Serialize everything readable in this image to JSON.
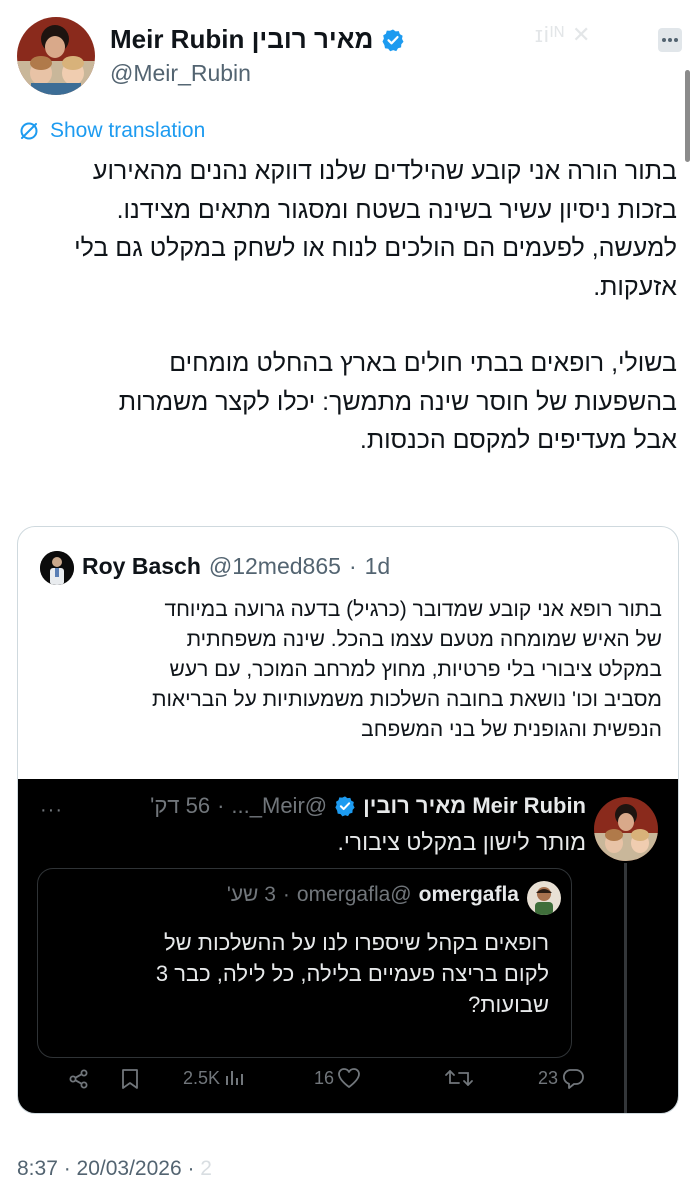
{
  "author": {
    "name": "Meir Rubin מאיר רובין",
    "handle": "@Meir_Rubin",
    "verified": true
  },
  "ghost_logo": "ɪiᴵᴺ ✕",
  "translate_label": "Show translation",
  "body": {
    "paragraph1": "בתור הורה אני קובע שהילדים שלנו דווקא נהנים מהאירוע\nבזכות ניסיון עשיר בשינה בשטח ומסגור מתאים מצידנו.\nלמעשה, לפעמים הם הולכים לנוח או לשחק במקלט גם בלי\nאזעקות.",
    "paragraph2": "בשולי, רופאים בבתי חולים בארץ בהחלט מומחים\nבהשפעות של חוסר שינה מתמשך: יכלו לקצר משמרות\nאבל מעדיפים למקסם הכנסות."
  },
  "quote": {
    "name": "Roy Basch",
    "handle": "@12med865",
    "time": "1d",
    "text": "בתור רופא אני קובע שמדובר (כרגיל) בדעה גרועה במיוחד\nשל האיש שמומחה מטעם עצמו בהכל. שינה משפחתית\nבמקלט ציבורי בלי פרטיות, מחוץ למרחב המוכר, עם רעש\nמסביב וכו' נושאת בחובה השלכות משמעותיות על הבריאות\nהנפשית והגופנית של בני המשפחב",
    "embedded": {
      "name": "Meir Rubin מאיר רובין",
      "handle": "@Meir_...",
      "time": "56 דק'",
      "text": "מותר לישון במקלט ציבורי.",
      "more": "···",
      "inner": {
        "name": "omergafla",
        "handle": "@omergafla",
        "time": "3 שע'",
        "text": "רופאים בקהל שיספרו לנו על ההשלכות של\nלקום בריצה פעמיים בלילה, כל לילה, כבר 3\nשבועות?"
      },
      "actions": {
        "views": "2.5K",
        "likes": "16",
        "replies": "23"
      }
    }
  },
  "timestamp": {
    "time": "8:37 · 20/03/2026 ·",
    "faded": " 2"
  },
  "colors": {
    "accent": "#1d9bf0",
    "text": "#0f1419",
    "muted": "#536471",
    "dark_bg": "#000000",
    "dark_text": "#e7e9ea",
    "dark_muted": "#71767b"
  }
}
